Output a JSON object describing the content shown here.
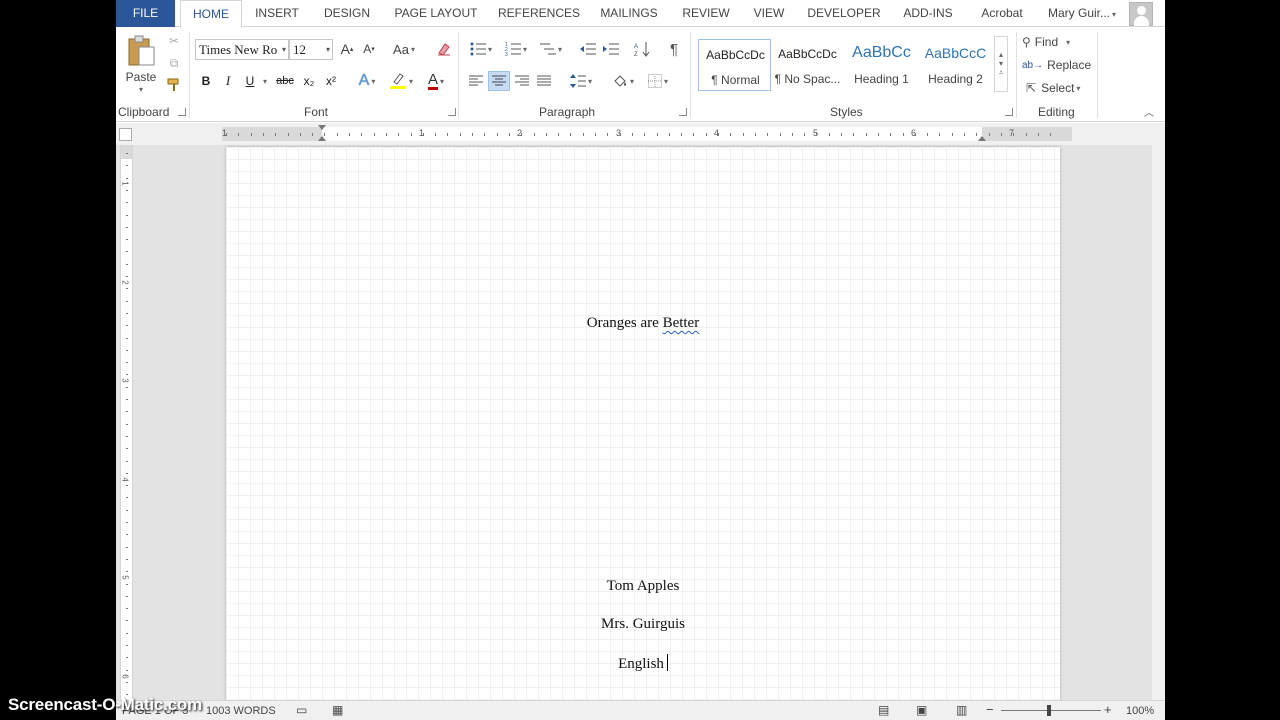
{
  "tabs": [
    {
      "label": "FILE"
    },
    {
      "label": "HOME"
    },
    {
      "label": "INSERT"
    },
    {
      "label": "DESIGN"
    },
    {
      "label": "PAGE LAYOUT"
    },
    {
      "label": "REFERENCES"
    },
    {
      "label": "MAILINGS"
    },
    {
      "label": "REVIEW"
    },
    {
      "label": "VIEW"
    },
    {
      "label": "DEVELOPER"
    },
    {
      "label": "ADD-INS"
    },
    {
      "label": "Acrobat"
    }
  ],
  "user": {
    "name": "Mary Guir..."
  },
  "clipboard": {
    "paste_label": "Paste",
    "group_label": "Clipboard"
  },
  "font": {
    "font_name": "Times New Ro",
    "font_size": "12",
    "case_label": "Aa",
    "bold": "B",
    "italic": "I",
    "underline": "U",
    "strike": "abc",
    "subscript": "x₂",
    "superscript": "x²",
    "group_label": "Font",
    "highlight_color": "#ffff00",
    "font_color": "#c00000"
  },
  "paragraph": {
    "group_label": "Paragraph"
  },
  "styles": {
    "items": [
      {
        "sample": "AaBbCcDc",
        "name": "¶ Normal"
      },
      {
        "sample": "AaBbCcDc",
        "name": "¶ No Spac..."
      },
      {
        "sample": "AaBbCc",
        "name": "Heading 1"
      },
      {
        "sample": "AaBbCcC",
        "name": "Heading 2"
      }
    ],
    "group_label": "Styles"
  },
  "editing": {
    "find": "Find",
    "replace": "Replace",
    "select": "Select",
    "group_label": "Editing"
  },
  "ruler": {
    "numbers": [
      "1",
      "1",
      "2",
      "3",
      "4",
      "5",
      "6",
      "7"
    ]
  },
  "vruler": {
    "numbers": [
      "1",
      "2",
      "3",
      "4",
      "5",
      "6"
    ]
  },
  "document": {
    "title_word1": "Oranges are ",
    "title_word2": "Better",
    "line1": "Tom Apples",
    "line2": "Mrs. Guirguis",
    "line3": "English"
  },
  "status": {
    "page": "PAGE 1 OF 5",
    "words": "1003 WORDS",
    "zoom": "100%"
  },
  "watermark": "Screencast-O-Matic.com",
  "colors": {
    "accent": "#2b579a"
  }
}
